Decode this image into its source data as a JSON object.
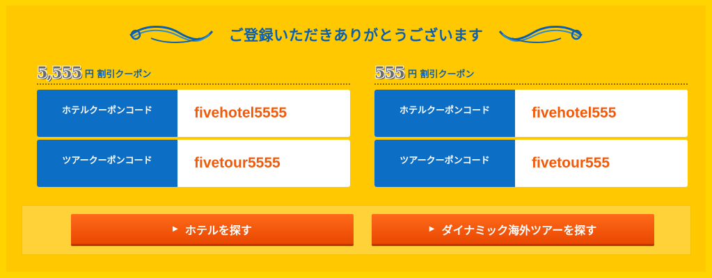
{
  "header": {
    "title": "ご登録いただきありがとうございます"
  },
  "coupons": [
    {
      "amount": "5,555",
      "unit_label": "円 割引クーポン",
      "rows": [
        {
          "label": "ホテルクーポンコード",
          "code": "fivehotel5555"
        },
        {
          "label": "ツアークーポンコード",
          "code": "fivetour5555"
        }
      ]
    },
    {
      "amount": "555",
      "unit_label": "円 割引クーポン",
      "rows": [
        {
          "label": "ホテルクーポンコード",
          "code": "fivehotel555"
        },
        {
          "label": "ツアークーポンコード",
          "code": "fivetour555"
        }
      ]
    }
  ],
  "buttons": {
    "hotel_label": "ホテルを探す",
    "tour_label": "ダイナミック海外ツアーを探す",
    "arrow_icon": "chevron-right-icon"
  },
  "colors": {
    "background": "#ffc800",
    "label_blue": "#0d6ec6",
    "code_orange": "#f15a0a",
    "button_orange": "#f05a10"
  }
}
